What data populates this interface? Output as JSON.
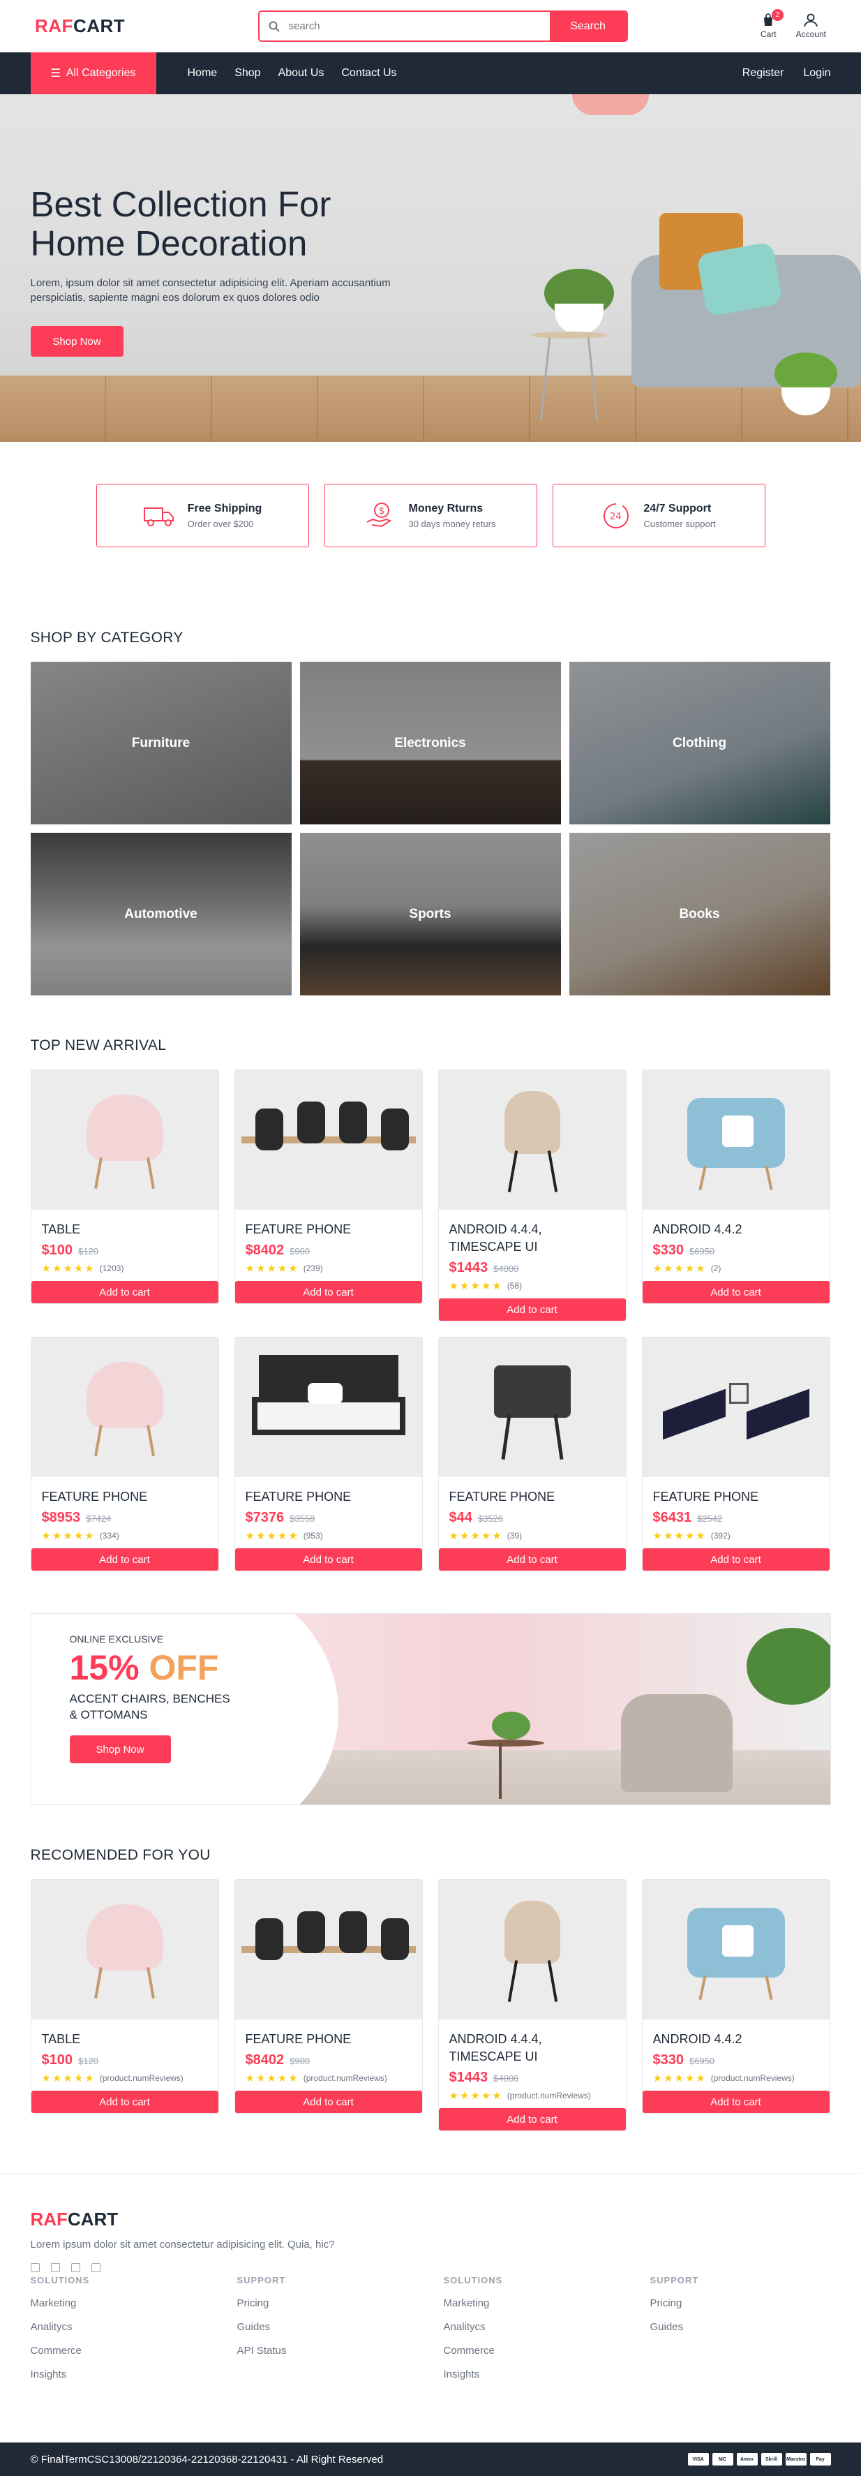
{
  "header": {
    "logo_a": "RAF",
    "logo_b": "CART",
    "search_placeholder": "search",
    "search_button": "Search",
    "cart_label": "Cart",
    "cart_count": "2",
    "account_label": "Account"
  },
  "nav": {
    "all_categories": "All Categories",
    "links": [
      "Home",
      "Shop",
      "About Us",
      "Contact Us"
    ],
    "register": "Register",
    "login": "Login"
  },
  "hero": {
    "title_line1": "Best Collection For",
    "title_line2": "Home Decoration",
    "text": "Lorem, ipsum dolor sit amet consectetur adipisicing elit. Aperiam accusantium perspiciatis, sapiente magni eos dolorum ex quos dolores odio",
    "button": "Shop Now"
  },
  "features": [
    {
      "title": "Free Shipping",
      "subtitle": "Order over $200",
      "icon": "truck-icon"
    },
    {
      "title": "Money Rturns",
      "subtitle": "30 days money returs",
      "icon": "money-hand-icon"
    },
    {
      "title": "24/7 Support",
      "subtitle": "Customer support",
      "icon": "support-clock-icon"
    }
  ],
  "category_section": {
    "title": "SHOP BY CATEGORY",
    "items": [
      "Furniture",
      "Electronics",
      "Clothing",
      "Automotive",
      "Sports",
      "Books"
    ]
  },
  "arrival_section": {
    "title": "TOP NEW ARRIVAL",
    "add_label": "Add to cart",
    "products": [
      {
        "name": "TABLE",
        "price": "$100",
        "old": "$120",
        "reviews": "(1203)"
      },
      {
        "name": "FEATURE PHONE",
        "price": "$8402",
        "old": "$900",
        "reviews": "(239)"
      },
      {
        "name": "ANDROID 4.4.4, TIMESCAPE UI",
        "price": "$1443",
        "old": "$4000",
        "reviews": "(58)"
      },
      {
        "name": "ANDROID 4.4.2",
        "price": "$330",
        "old": "$6950",
        "reviews": "(2)"
      },
      {
        "name": "FEATURE PHONE",
        "price": "$8953",
        "old": "$7424",
        "reviews": "(334)"
      },
      {
        "name": "FEATURE PHONE",
        "price": "$7376",
        "old": "$3558",
        "reviews": "(953)"
      },
      {
        "name": "FEATURE PHONE",
        "price": "$44",
        "old": "$3526",
        "reviews": "(39)"
      },
      {
        "name": "FEATURE PHONE",
        "price": "$6431",
        "old": "$2542",
        "reviews": "(392)"
      }
    ]
  },
  "banner": {
    "small": "ONLINE EXCLUSIVE",
    "pct_num": "15%",
    "pct_off": "OFF",
    "desc": "ACCENT CHAIRS, BENCHES & OTTOMANS",
    "button": "Shop Now"
  },
  "recommend_section": {
    "title": "RECOMENDED FOR YOU",
    "add_label": "Add to cart",
    "products": [
      {
        "name": "TABLE",
        "price": "$100",
        "old": "$120",
        "reviews": "(product.numReviews)"
      },
      {
        "name": "FEATURE PHONE",
        "price": "$8402",
        "old": "$900",
        "reviews": "(product.numReviews)"
      },
      {
        "name": "ANDROID 4.4.4, TIMESCAPE UI",
        "price": "$1443",
        "old": "$4000",
        "reviews": "(product.numReviews)"
      },
      {
        "name": "ANDROID 4.4.2",
        "price": "$330",
        "old": "$6950",
        "reviews": "(product.numReviews)"
      }
    ]
  },
  "footer": {
    "logo_a": "RAF",
    "logo_b": "CART",
    "desc": "Lorem ipsum dolor sit amet consectetur adipisicing elit. Quia, hic?",
    "columns": [
      {
        "title": "SOLUTIONS",
        "links": [
          "Marketing",
          "Analitycs",
          "Commerce",
          "Insights"
        ]
      },
      {
        "title": "SUPPORT",
        "links": [
          "Pricing",
          "Guides",
          "API Status"
        ]
      },
      {
        "title": "SOLUTIONS",
        "links": [
          "Marketing",
          "Analitycs",
          "Commerce",
          "Insights"
        ]
      },
      {
        "title": "SUPPORT",
        "links": [
          "Pricing",
          "Guides"
        ]
      }
    ],
    "copyright": "© FinalTermCSC13008/22120364-22120368-22120431 - All Right Reserved",
    "payments": [
      "VISA",
      "MC",
      "Amex",
      "Skrill",
      "Maestro",
      "Pay"
    ]
  },
  "colors": {
    "accent": "#fd3d57",
    "dark": "#1f2937"
  }
}
